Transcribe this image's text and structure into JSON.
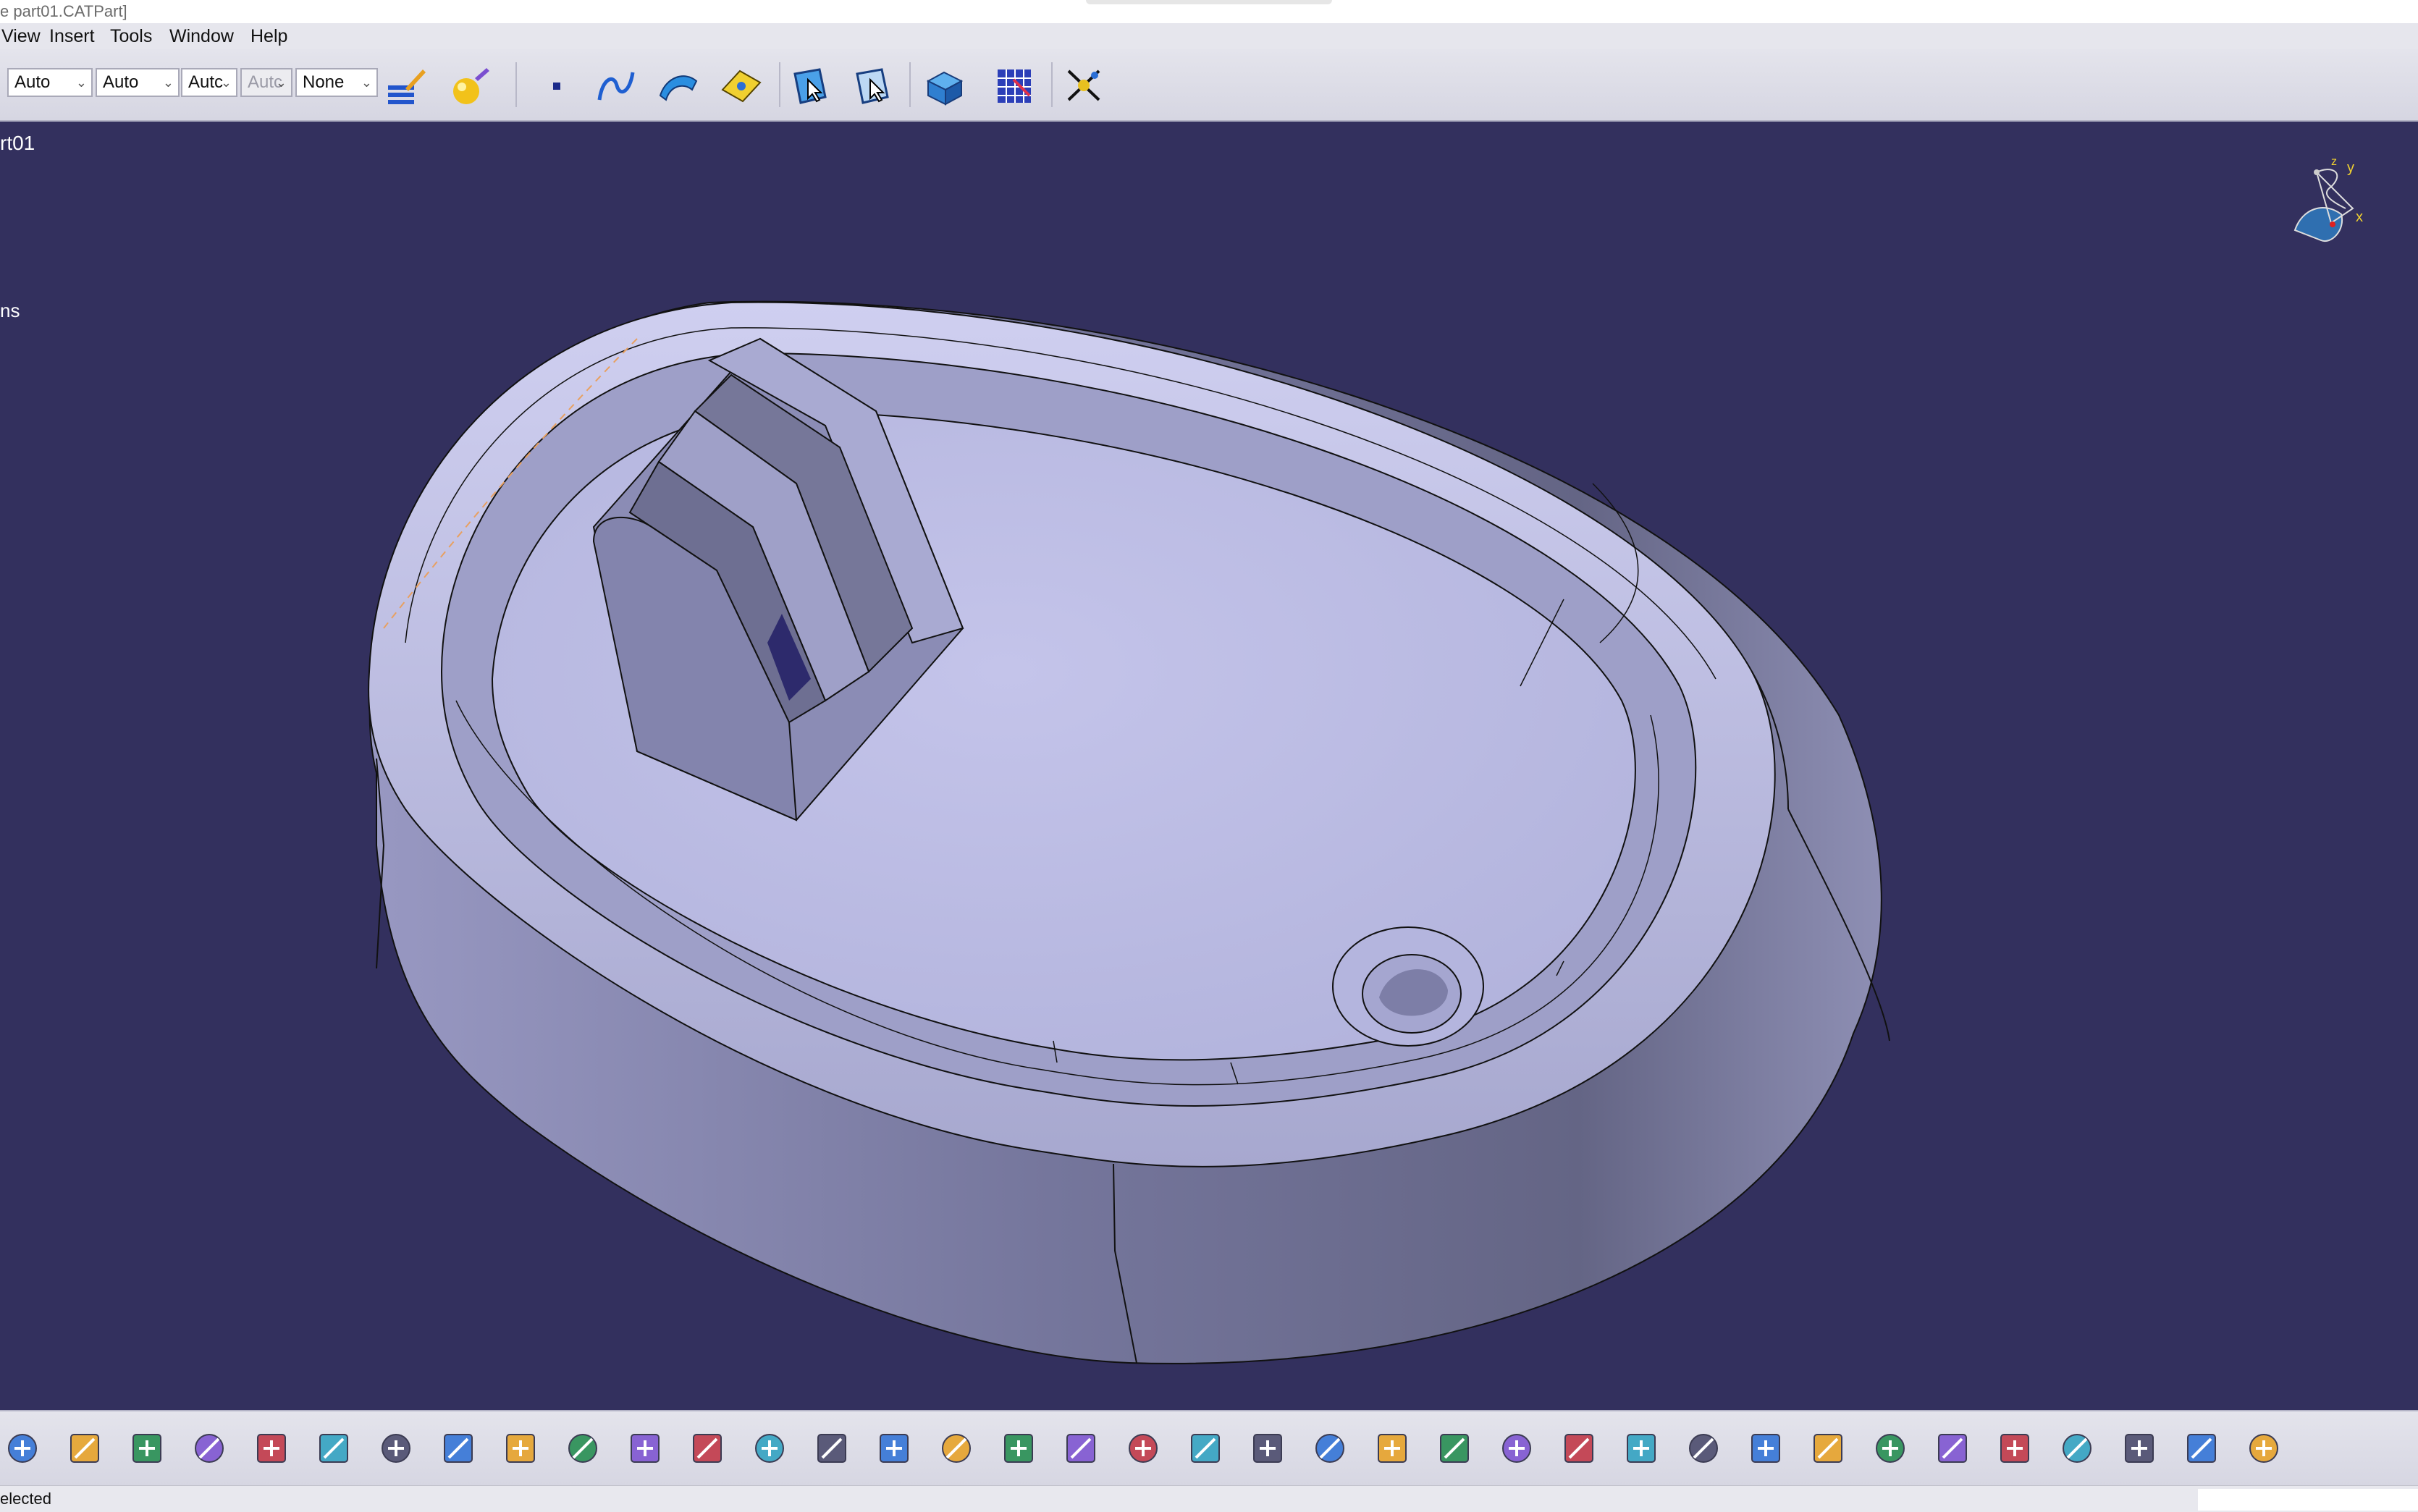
{
  "window": {
    "title": "e part01.CATPart]"
  },
  "menu": [
    "View",
    "Insert",
    "Tools",
    "Window",
    "Help"
  ],
  "toolbar": {
    "combos": [
      {
        "value": "Auto",
        "disabled": false
      },
      {
        "value": "Auto",
        "disabled": false
      },
      {
        "value": "Autc",
        "disabled": false
      },
      {
        "value": "Autc",
        "disabled": true
      },
      {
        "value": "None",
        "disabled": false
      }
    ],
    "icons": [
      "painter-icon",
      "material-sphere-icon",
      "point-icon",
      "spline-icon",
      "surface-icon",
      "plane-icon",
      "select-icon",
      "select-trap-icon",
      "3d-view-icon",
      "grid-icon",
      "snap-icon"
    ]
  },
  "tree": {
    "root": "rt01",
    "item": "ns"
  },
  "compass": {
    "y": "y",
    "x": "x",
    "z": "z"
  },
  "bottom_toolbar": {
    "icons": [
      "print-icon",
      "cut-icon",
      "copy-icon",
      "paste-icon",
      "undo-icon",
      "redo-icon",
      "help-icon",
      "formula-icon",
      "comment-icon",
      "knowledge-icon",
      "table-icon",
      "graph-icon",
      "lock-icon",
      "tree-icon",
      "fly-icon",
      "fit-all-icon",
      "pan-icon",
      "rotate-icon",
      "zoom-in-icon",
      "zoom-out-icon",
      "normal-view-icon",
      "multi-view-icon",
      "iso-view-icon",
      "shading-icon",
      "hide-show-icon",
      "swap-icon",
      "measure-icon",
      "measure-between-icon",
      "measure-item-icon",
      "mass-icon",
      "capture-icon",
      "analysis-icon",
      "sync-icon",
      "update-icon",
      "axis-icon",
      "units-icon",
      "cylinder-icon"
    ]
  },
  "status": {
    "text": "elected"
  }
}
